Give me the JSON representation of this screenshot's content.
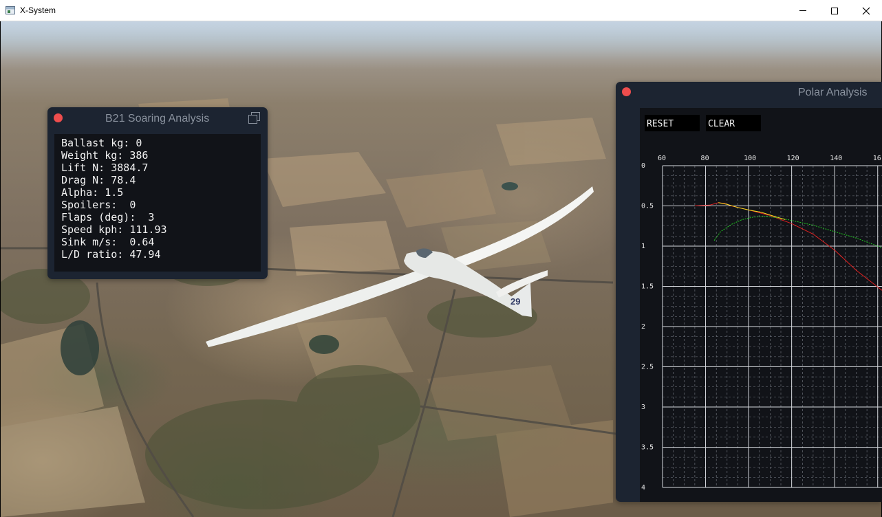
{
  "window": {
    "title": "X-System",
    "min_label": "",
    "max_label": "",
    "close_label": ""
  },
  "soaring_panel": {
    "title": "B21 Soaring Analysis",
    "lines": [
      "Ballast kg: 0",
      "Weight kg: 386",
      "Lift N: 3884.7",
      "Drag N: 78.4",
      "Alpha: 1.5",
      "Spoilers:  0",
      "Flaps (deg):  3",
      "Speed kph: 111.93",
      "Sink m/s:  0.64",
      "L/D ratio: 47.94"
    ]
  },
  "polar_panel": {
    "title": "Polar Analysis",
    "reset_label": "RESET",
    "clear_label": "CLEAR"
  },
  "glider": {
    "tail_number": "29"
  },
  "colors": {
    "panel_bg": "#1c2431",
    "plot_bg": "#111318",
    "close_dot": "#ee4d4d",
    "series_red": "#e02020",
    "series_green": "#22cc22",
    "series_yellow": "#f0e020"
  },
  "chart_data": {
    "type": "line",
    "title": "",
    "xlabel": "",
    "ylabel": "",
    "x_ticks": [
      "60",
      "80",
      "100",
      "120",
      "140",
      "16"
    ],
    "y_ticks": [
      "0",
      "0.5",
      "1",
      "1.5",
      "2",
      "2.5",
      "3",
      "3.5",
      "4"
    ],
    "xlim": [
      60,
      162
    ],
    "ylim": [
      0,
      4
    ],
    "y_inverted": true,
    "grid": true,
    "series": [
      {
        "color": "red",
        "points": [
          [
            75,
            0.5
          ],
          [
            82,
            0.49
          ],
          [
            86,
            0.46
          ],
          [
            89,
            0.47
          ],
          [
            92,
            0.5
          ],
          [
            100,
            0.55
          ],
          [
            110,
            0.62
          ],
          [
            120,
            0.72
          ],
          [
            130,
            0.85
          ],
          [
            140,
            1.05
          ],
          [
            150,
            1.3
          ],
          [
            162,
            1.55
          ]
        ]
      },
      {
        "color": "yellow",
        "points": [
          [
            86,
            0.46
          ],
          [
            90,
            0.48
          ],
          [
            95,
            0.52
          ],
          [
            100,
            0.55
          ],
          [
            106,
            0.58
          ],
          [
            112,
            0.63
          ],
          [
            117,
            0.67
          ]
        ]
      },
      {
        "color": "green",
        "points": [
          [
            84,
            0.93
          ],
          [
            87,
            0.82
          ],
          [
            92,
            0.73
          ],
          [
            97,
            0.67
          ],
          [
            102,
            0.64
          ],
          [
            108,
            0.63
          ],
          [
            114,
            0.65
          ],
          [
            120,
            0.68
          ],
          [
            130,
            0.74
          ],
          [
            140,
            0.82
          ],
          [
            150,
            0.9
          ],
          [
            162,
            1.02
          ]
        ]
      }
    ]
  }
}
